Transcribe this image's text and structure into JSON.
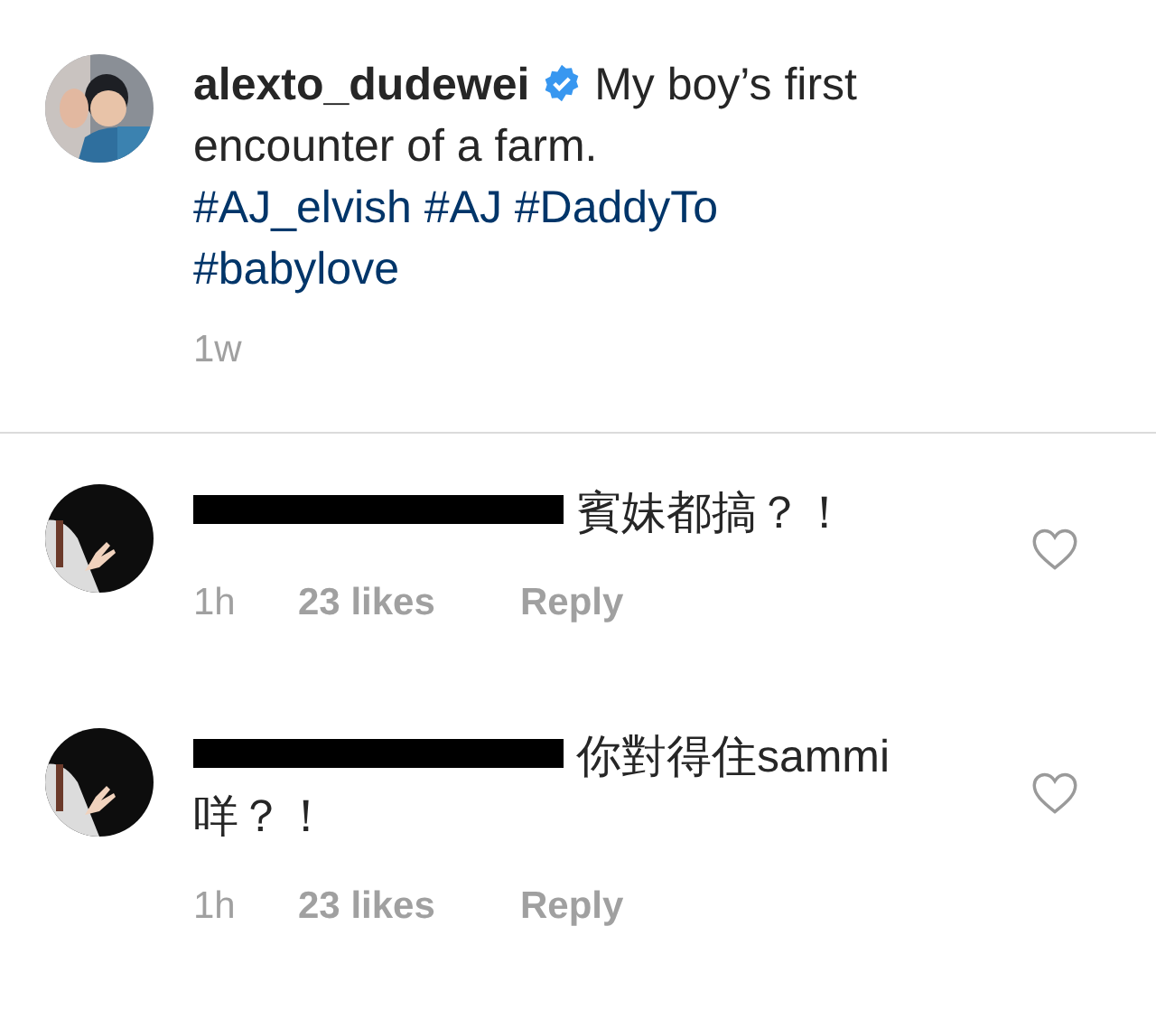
{
  "post": {
    "username": "alexto_dudewei",
    "verified": true,
    "caption_lines": [
      "My boy’s first",
      "encounter of a farm."
    ],
    "hashtags": [
      "#AJ_elvish",
      "#AJ",
      "#DaddyTo",
      "#babylove"
    ],
    "time": "1w"
  },
  "comments": [
    {
      "username_redacted": true,
      "text_lines": [
        "賓妹都搞？！"
      ],
      "time": "1h",
      "likes": "23 likes",
      "reply": "Reply",
      "liked": false
    },
    {
      "username_redacted": true,
      "text_lines": [
        "你對得住sammi",
        "咩？！"
      ],
      "time": "1h",
      "likes": "23 likes",
      "reply": "Reply",
      "liked": false
    }
  ]
}
